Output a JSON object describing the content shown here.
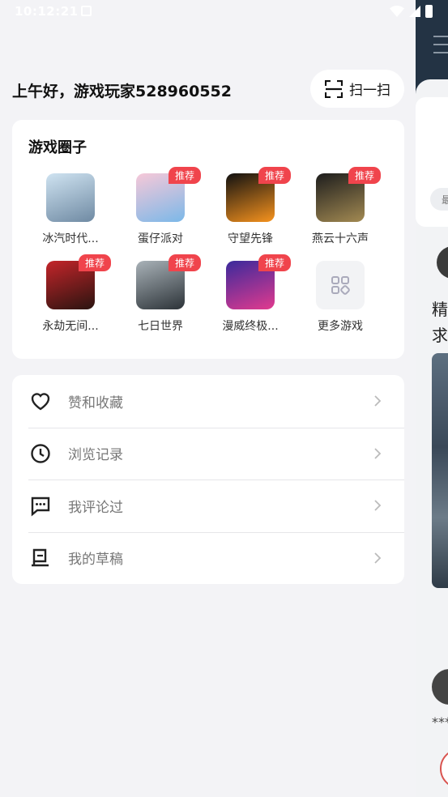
{
  "status_bar": {
    "time": "10:12:21"
  },
  "greeting": "上午好，游戏玩家528960552",
  "scan": {
    "label": "扫一扫"
  },
  "game_circle": {
    "title": "游戏圈子",
    "badge_label": "推荐",
    "games": [
      {
        "name": "冰汽时代...",
        "badge": false,
        "colors": [
          "#cfe3f1",
          "#6f8aa3"
        ]
      },
      {
        "name": "蛋仔派对",
        "badge": true,
        "colors": [
          "#f7c8d8",
          "#7bb8e8"
        ]
      },
      {
        "name": "守望先锋",
        "badge": true,
        "colors": [
          "#111111",
          "#f7931e"
        ]
      },
      {
        "name": "燕云十六声",
        "badge": true,
        "colors": [
          "#1d1d1d",
          "#a38a52"
        ]
      },
      {
        "name": "永劫无间...",
        "badge": true,
        "colors": [
          "#c4252a",
          "#2a1410"
        ]
      },
      {
        "name": "七日世界",
        "badge": true,
        "colors": [
          "#a9b2b8",
          "#2c3338"
        ]
      },
      {
        "name": "漫威终极...",
        "badge": true,
        "colors": [
          "#3a2a9c",
          "#e23a8e"
        ]
      },
      {
        "name": "更多游戏",
        "badge": false,
        "colors": [
          "#f2f3f5",
          "#f2f3f5"
        ]
      }
    ]
  },
  "menu": {
    "items": [
      {
        "label": "赞和收藏",
        "icon": "heart-icon"
      },
      {
        "label": "浏览记录",
        "icon": "clock-icon"
      },
      {
        "label": "我评论过",
        "icon": "comment-icon"
      },
      {
        "label": "我的草稿",
        "icon": "draft-icon"
      }
    ]
  },
  "background_screen": {
    "chip_text": "最",
    "text_line_1": "精",
    "text_line_2": "求",
    "stars": "***"
  },
  "colors": {
    "badge": "#f0444c",
    "drawer_bg": "#f3f3f6",
    "card_bg": "#ffffff"
  }
}
